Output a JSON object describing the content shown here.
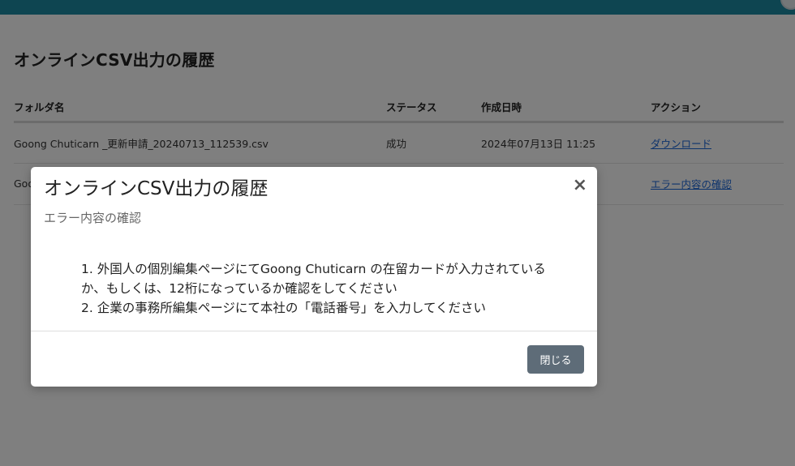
{
  "page": {
    "title": "オンラインCSV出力の履歴"
  },
  "table": {
    "headers": [
      "フォルダ名",
      "ステータス",
      "作成日時",
      "アクション"
    ],
    "rows": [
      {
        "folder": "Goong Chuticarn _更新申請_20240713_112539.csv",
        "status": "成功",
        "created": "2024年07月13日 11:25",
        "action": "ダウンロード"
      },
      {
        "folder": "Goo",
        "status": "",
        "created": "",
        "action": "エラー内容の確認"
      }
    ]
  },
  "modal": {
    "title": "オンラインCSV出力の履歴",
    "subtitle": "エラー内容の確認",
    "close_symbol": "×",
    "errors": [
      "1. 外国人の個別編集ページにてGoong Chuticarn の在留カードが入力されているか、もしくは、12桁になっているか確認をしてください",
      "2. 企業の事務所編集ページにて本社の「電話番号」を入力してください"
    ],
    "close_label": "閉じる"
  },
  "colors": {
    "topbar": "#1c8ba3",
    "link": "#1a66d8",
    "button": "#5e6c78"
  }
}
